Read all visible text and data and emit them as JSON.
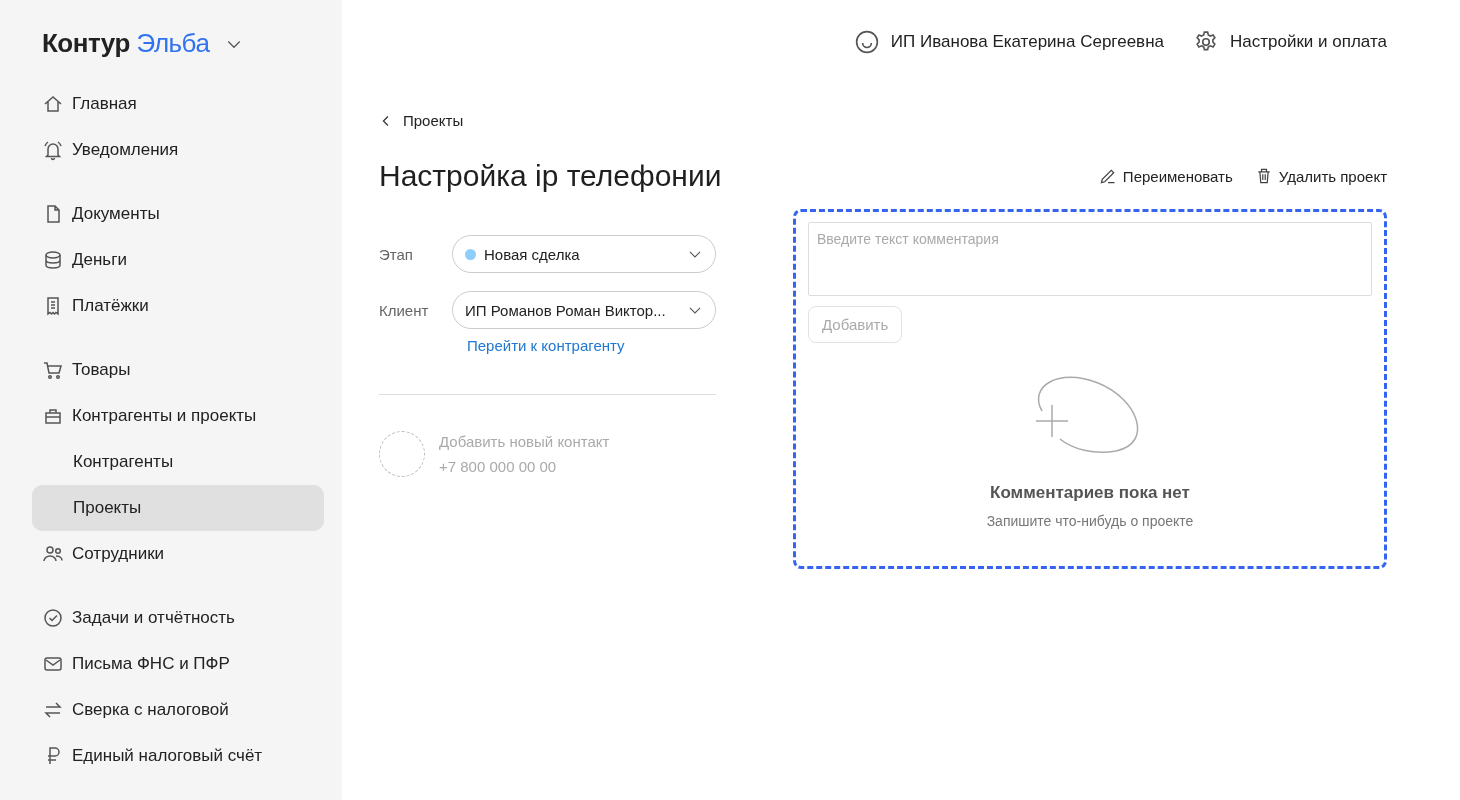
{
  "logo": {
    "brand": "Контур",
    "product": "Эльба"
  },
  "sidebar": {
    "groups": [
      [
        {
          "label": "Главная",
          "selected": false
        },
        {
          "label": "Уведомления",
          "selected": false
        }
      ],
      [
        {
          "label": "Документы",
          "selected": false
        },
        {
          "label": "Деньги",
          "selected": false
        },
        {
          "label": "Платёжки",
          "selected": false
        }
      ],
      [
        {
          "label": "Товары",
          "selected": false
        },
        {
          "label": "Контрагенты и проекты",
          "selected": false,
          "children": [
            {
              "label": "Контрагенты",
              "selected": false
            },
            {
              "label": "Проекты",
              "selected": true
            }
          ]
        },
        {
          "label": "Сотрудники",
          "selected": false
        }
      ],
      [
        {
          "label": "Задачи и отчётность",
          "selected": false
        },
        {
          "label": "Письма ФНС и ПФР",
          "selected": false
        },
        {
          "label": "Сверка с налоговой",
          "selected": false
        },
        {
          "label": "Единый налоговый счёт",
          "selected": false
        }
      ]
    ]
  },
  "header": {
    "account": "ИП Иванова Екатерина Сергеевна",
    "settings": "Настройки и оплата"
  },
  "breadcrumb": "Проекты",
  "title": "Настройка ip телефонии",
  "actions": [
    "Переименовать",
    "Удалить проект"
  ],
  "fields": [
    {
      "label": "Этап",
      "value": "Новая сделка",
      "color": "#8ecdfc"
    },
    {
      "label": "Клиент",
      "value": "ИП Романов Роман Виктор..."
    }
  ],
  "client_link": "Перейти к контрагенту",
  "contact": {
    "name": "Добавить новый контакт",
    "phone": "+7 800 000 00 00"
  },
  "comments": {
    "placeholder": "Введите текст комментария",
    "button": "Добавить",
    "empty_title": "Комментариев пока нет",
    "empty_hint": "Запишите что-нибудь о проекте"
  }
}
